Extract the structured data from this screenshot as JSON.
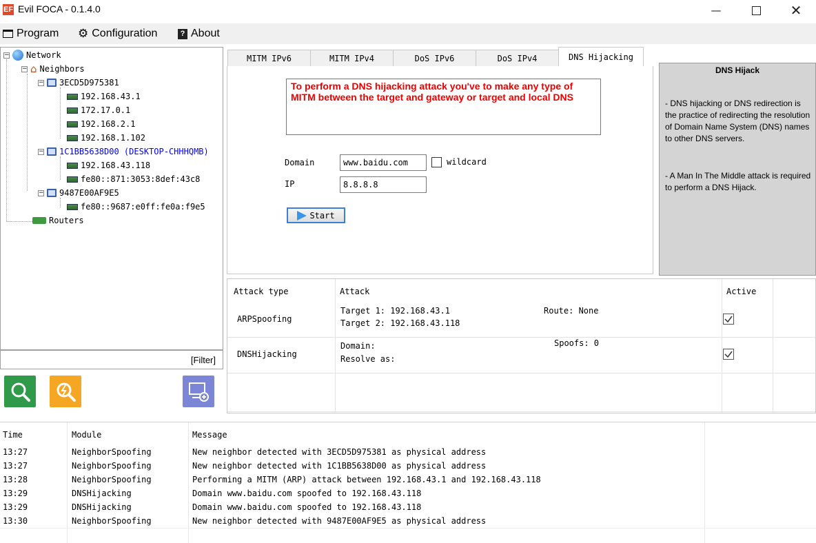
{
  "window": {
    "title": "Evil FOCA - 0.1.4.0",
    "app_icon_text": "EF"
  },
  "menu": {
    "items": [
      {
        "label": "Program",
        "icon": "window-icon"
      },
      {
        "label": "Configuration",
        "icon": "gear-icon"
      },
      {
        "label": "About",
        "icon": "help-book-icon"
      }
    ]
  },
  "tree": {
    "root": "Network",
    "neighbors_label": "Neighbors",
    "hosts": [
      {
        "name": "3ECD5D975381",
        "ips": [
          "192.168.43.1",
          "172.17.0.1",
          "192.168.2.1",
          "192.168.1.102"
        ],
        "highlighted": false
      },
      {
        "name": "1C1BB5638D00 (DESKTOP-CHHHQMB)",
        "ips": [
          "192.168.43.118",
          "fe80::871:3053:8def:43c8"
        ],
        "highlighted": true,
        "highlight_color": "#0000ff"
      },
      {
        "name": "9487E00AF9E5",
        "ips": [
          "fe80::9687:e0ff:fe0a:f9e5"
        ],
        "highlighted": false
      }
    ],
    "routers_label": "Routers"
  },
  "filter": {
    "label": "[Filter]"
  },
  "action_buttons": [
    {
      "name": "scan-button",
      "color": "#2e9a4a",
      "icon": "magnifier-icon"
    },
    {
      "name": "attack-button",
      "color": "#f5a623",
      "icon": "bolt-magnifier-icon"
    },
    {
      "name": "add-computer-button",
      "color": "#7b86d6",
      "icon": "add-computer-icon"
    }
  ],
  "tabs": [
    {
      "label": "MITM IPv6",
      "active": false
    },
    {
      "label": "MITM IPv4",
      "active": false
    },
    {
      "label": "DoS IPv6",
      "active": false
    },
    {
      "label": "DoS IPv4",
      "active": false
    },
    {
      "label": "DNS Hijacking",
      "active": true
    }
  ],
  "dns_form": {
    "warning": "To perform a DNS hijacking attack you've to make any type of MITM between the target and gateway or target and local DNS",
    "domain_label": "Domain",
    "domain_value": "www.baidu.com",
    "wildcard_label": "wildcard",
    "wildcard_checked": false,
    "ip_label": "IP",
    "ip_value": "8.8.8.8",
    "start_label": "Start"
  },
  "help": {
    "title": "DNS Hijack",
    "p1": "- DNS hijacking or DNS redirection is the practice of redirecting the resolution of Domain Name System (DNS) names to other DNS servers.",
    "p2": "- A Man In The Middle attack is required to perform a DNS Hijack."
  },
  "attacks": {
    "headers": {
      "type": "Attack type",
      "attack": "Attack",
      "active": "Active"
    },
    "rows": [
      {
        "type": "ARPSpoofing",
        "line1": "Target 1: 192.168.43.1",
        "line2": "Target 2: 192.168.43.118",
        "extra": "Route: None",
        "active": true
      },
      {
        "type": "DNSHijacking",
        "line1": "Domain:",
        "line2": "Resolve as:",
        "extra": "Spoofs: 0",
        "active": true
      }
    ]
  },
  "log": {
    "headers": {
      "time": "Time",
      "module": "Module",
      "message": "Message"
    },
    "rows": [
      {
        "time": "13:27",
        "module": "NeighborSpoofing",
        "message": "New neighbor detected with 3ECD5D975381 as physical address"
      },
      {
        "time": "13:27",
        "module": "NeighborSpoofing",
        "message": "New neighbor detected with 1C1BB5638D00 as physical address"
      },
      {
        "time": "13:28",
        "module": "NeighborSpoofing",
        "message": "Performing a MITM (ARP) attack between 192.168.43.1 and 192.168.43.118"
      },
      {
        "time": "13:29",
        "module": "DNSHijacking",
        "message": "Domain www.baidu.com spoofed to 192.168.43.118"
      },
      {
        "time": "13:29",
        "module": "DNSHijacking",
        "message": "Domain www.baidu.com spoofed to 192.168.43.118"
      },
      {
        "time": "13:30",
        "module": "NeighborSpoofing",
        "message": "New neighbor detected with 9487E00AF9E5 as physical address"
      }
    ]
  }
}
